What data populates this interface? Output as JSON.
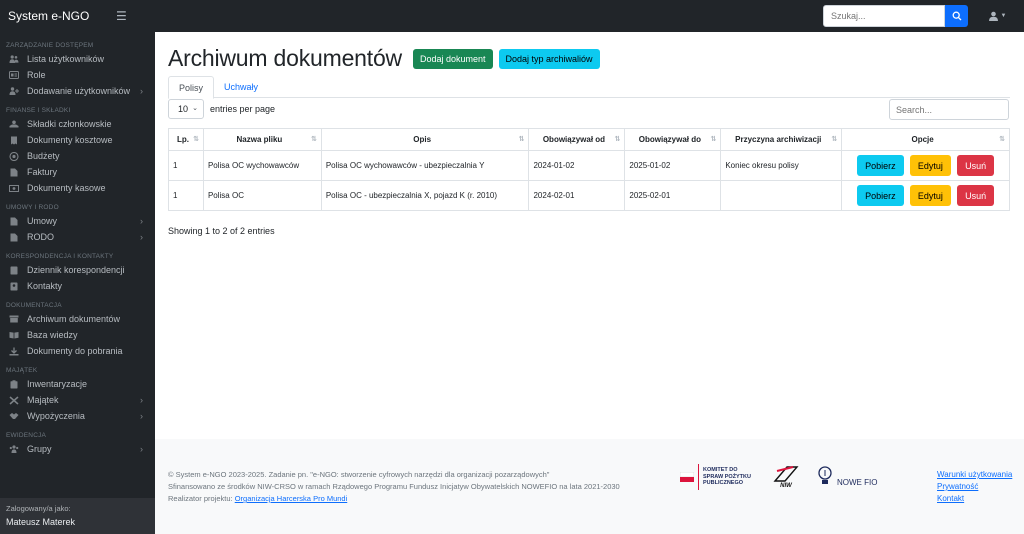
{
  "app": {
    "brand": "System e-NGO",
    "search_placeholder": "Szukaj..."
  },
  "sidebar": {
    "sections": [
      {
        "heading": "ZARZĄDZANIE DOSTĘPEM",
        "items": [
          {
            "label": "Lista użytkowników",
            "icon": "users-icon",
            "chevron": false
          },
          {
            "label": "Role",
            "icon": "id-card-icon",
            "chevron": false
          },
          {
            "label": "Dodawanie użytkowników",
            "icon": "user-plus-icon",
            "chevron": true
          }
        ]
      },
      {
        "heading": "FINANSE I SKŁADKI",
        "items": [
          {
            "label": "Składki członkowskie",
            "icon": "hands-icon",
            "chevron": false
          },
          {
            "label": "Dokumenty kosztowe",
            "icon": "receipt-icon",
            "chevron": false
          },
          {
            "label": "Budżety",
            "icon": "coins-icon",
            "chevron": false
          },
          {
            "label": "Faktury",
            "icon": "invoice-icon",
            "chevron": false
          },
          {
            "label": "Dokumenty kasowe",
            "icon": "cash-icon",
            "chevron": false
          }
        ]
      },
      {
        "heading": "UMOWY I RODO",
        "items": [
          {
            "label": "Umowy",
            "icon": "file-icon",
            "chevron": true
          },
          {
            "label": "RODO",
            "icon": "file-icon",
            "chevron": true
          }
        ]
      },
      {
        "heading": "KORESPONDENCJA I KONTAKTY",
        "items": [
          {
            "label": "Dziennik korespondencji",
            "icon": "book-icon",
            "chevron": false
          },
          {
            "label": "Kontakty",
            "icon": "contact-icon",
            "chevron": false
          }
        ]
      },
      {
        "heading": "DOKUMENTACJA",
        "items": [
          {
            "label": "Archiwum dokumentów",
            "icon": "archive-icon",
            "chevron": false
          },
          {
            "label": "Baza wiedzy",
            "icon": "book-open-icon",
            "chevron": false
          },
          {
            "label": "Dokumenty do pobrania",
            "icon": "download-icon",
            "chevron": false
          }
        ]
      },
      {
        "heading": "MAJĄTEK",
        "items": [
          {
            "label": "Inwentaryzacje",
            "icon": "clipboard-icon",
            "chevron": false
          },
          {
            "label": "Majątek",
            "icon": "tools-icon",
            "chevron": true
          },
          {
            "label": "Wypożyczenia",
            "icon": "handshake-icon",
            "chevron": true
          }
        ]
      },
      {
        "heading": "EWIDENCJA",
        "items": [
          {
            "label": "Grupy",
            "icon": "group-icon",
            "chevron": true
          }
        ]
      }
    ],
    "footer_label": "Zalogowany/a jako:",
    "footer_user": "Mateusz Materek"
  },
  "main": {
    "title": "Archiwum dokumentów",
    "btn_add_document": "Dodaj dokument",
    "btn_add_type": "Dodaj typ archiwaliów",
    "tabs": [
      {
        "label": "Polisy",
        "active": true
      },
      {
        "label": "Uchwały",
        "active": false
      }
    ],
    "page_length": "10",
    "entries_label": "entries per page",
    "search_placeholder": "Search...",
    "columns": [
      "Lp.",
      "Nazwa pliku",
      "Opis",
      "Obowiązywał od",
      "Obowiązywał do",
      "Przyczyna archiwizacji",
      "Opcje"
    ],
    "rows": [
      [
        "1",
        "Polisa OC wychowawców",
        "Polisa OC wychowawców - ubezpieczalnia Y",
        "2024-01-02",
        "2025-01-02",
        "Koniec okresu polisy"
      ],
      [
        "1",
        "Polisa OC",
        "Polisa OC - ubezpieczalnia X, pojazd K (r. 2010)",
        "2024-02-01",
        "2025-02-01",
        ""
      ]
    ],
    "row_actions": {
      "download": "Pobierz",
      "edit": "Edytuj",
      "delete": "Usuń"
    },
    "info": "Showing 1 to 2 of 2 entries"
  },
  "footer": {
    "line1": "© System e-NGO 2023-2025. Zadanie pn. \"e-NGO: stworzenie cyfrowych narzędzi dla organizacji pozarządowych\"",
    "line2": "Sfinansowano ze środków NIW-CRSO w ramach Rządowego Programu Fundusz Inicjatyw Obywatelskich NOWEFIO na lata 2021-2030",
    "line3_prefix": "Realizator projektu: ",
    "line3_link": "Organizacja Harcerska Pro Mundi",
    "logo1_text": "KOMITET DO SPRAW POŻYTKU PUBLICZNEGO",
    "logo2_text": "NIW",
    "logo3_text": "NOWE FIO",
    "links": [
      "Warunki użytkowania",
      "Prywatność",
      "Kontakt"
    ]
  },
  "colors": {
    "dark": "#212529",
    "primary": "#0d6efd",
    "success": "#198754",
    "info": "#0dcaf0",
    "warning": "#ffc107",
    "danger": "#dc3545"
  }
}
